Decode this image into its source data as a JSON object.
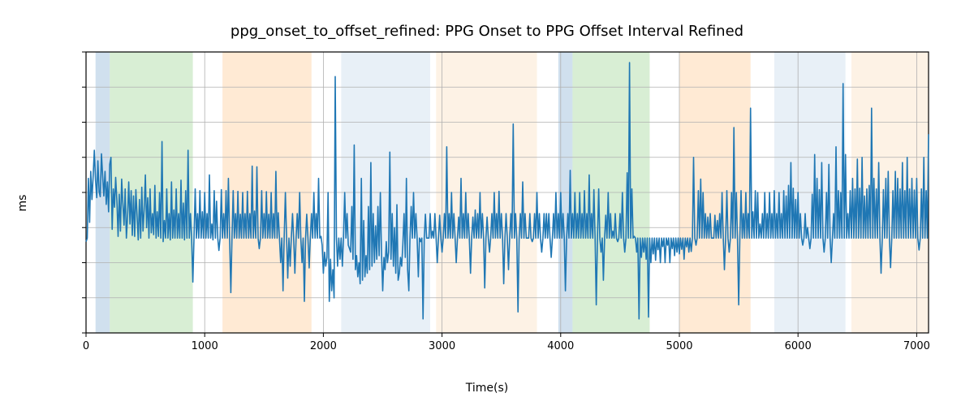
{
  "chart_data": {
    "type": "line",
    "title": "ppg_onset_to_offset_refined: PPG Onset to PPG Offset Interval Refined",
    "xlabel": "Time(s)",
    "ylabel": "ms",
    "xlim": [
      0,
      7100
    ],
    "ylim": [
      600,
      1400
    ],
    "xticks": [
      0,
      1000,
      2000,
      3000,
      4000,
      5000,
      6000,
      7000
    ],
    "yticks": [
      600,
      700,
      800,
      900,
      1000,
      1100,
      1200,
      1300,
      1400
    ],
    "grid": true,
    "regions": [
      {
        "x0": 80,
        "x1": 200,
        "color": "#a9c6e0"
      },
      {
        "x0": 200,
        "x1": 900,
        "color": "#b8e0b0"
      },
      {
        "x0": 1150,
        "x1": 1900,
        "color": "#ffd8b0"
      },
      {
        "x0": 2150,
        "x1": 2900,
        "color": "#d6e4f0"
      },
      {
        "x0": 2950,
        "x1": 3800,
        "color": "#fce8d0"
      },
      {
        "x0": 3980,
        "x1": 4100,
        "color": "#a9c6e0"
      },
      {
        "x0": 4100,
        "x1": 4750,
        "color": "#b8e0b0"
      },
      {
        "x0": 5000,
        "x1": 5600,
        "color": "#ffd8b0"
      },
      {
        "x0": 5800,
        "x1": 6400,
        "color": "#d6e4f0"
      },
      {
        "x0": 6450,
        "x1": 7100,
        "color": "#fce8d0"
      }
    ],
    "series": [
      {
        "name": "ppg_onset_to_offset_refined",
        "color": "#1f77b4",
        "x_step": 10,
        "values": [
          860,
          870,
          1040,
          915,
          1060,
          980,
          1048,
          1120,
          1035,
          985,
          1090,
          1002,
          988,
          1110,
          1045,
          990,
          1060,
          966,
          1030,
          945,
          1080,
          1100,
          895,
          1010,
          958,
          1043,
          978,
          875,
          995,
          890,
          1038,
          970,
          907,
          1010,
          870,
          933,
          1030,
          910,
          1005,
          878,
          990,
          875,
          1008,
          932,
          865,
          980,
          870,
          1015,
          890,
          950,
          1050,
          900,
          985,
          870,
          1010,
          885,
          940,
          880,
          1020,
          870,
          945,
          875,
          1000,
          870,
          1145,
          860,
          920,
          870,
          1010,
          870,
          940,
          865,
          1030,
          870,
          950,
          870,
          1010,
          870,
          940,
          870,
          1035,
          870,
          970,
          865,
          1005,
          870,
          1120,
          870,
          940,
          870,
          745,
          870,
          1010,
          870,
          940,
          870,
          1005,
          870,
          945,
          870,
          1000,
          870,
          940,
          870,
          1050,
          870,
          910,
          865,
          1005,
          870,
          975,
          870,
          835,
          870,
          1008,
          870,
          940,
          870,
          1005,
          870,
          1040,
          870,
          715,
          870,
          1005,
          870,
          940,
          870,
          1003,
          870,
          938,
          870,
          1000,
          870,
          940,
          870,
          1003,
          870,
          940,
          870,
          1075,
          870,
          947,
          870,
          1073,
          870,
          840,
          870,
          1005,
          870,
          940,
          870,
          1002,
          870,
          938,
          870,
          1000,
          870,
          940,
          870,
          1060,
          870,
          942,
          870,
          800,
          870,
          720,
          870,
          1000,
          870,
          756,
          870,
          790,
          870,
          940,
          870,
          770,
          870,
          940,
          870,
          1000,
          870,
          800,
          870,
          690,
          870,
          938,
          870,
          785,
          870,
          940,
          870,
          1000,
          870,
          940,
          870,
          1040,
          870,
          875,
          850,
          770,
          830,
          790,
          815,
          1000,
          690,
          810,
          720,
          780,
          700,
          1330,
          870,
          790,
          870,
          810,
          870,
          790,
          870,
          1000,
          870,
          940,
          850,
          840,
          830,
          960,
          810,
          1135,
          780,
          820,
          760,
          800,
          740,
          1040,
          750,
          920,
          760,
          820,
          770,
          960,
          780,
          1085,
          790,
          940,
          800,
          905,
          810,
          960,
          820,
          1000,
          830,
          720,
          815,
          780,
          860,
          800,
          830,
          1115,
          810,
          940,
          790,
          900,
          770,
          965,
          750,
          770,
          815,
          790,
          850,
          940,
          815,
          1040,
          780,
          720,
          870,
          960,
          870,
          1000,
          870,
          940,
          870,
          760,
          870,
          860,
          870,
          640,
          870,
          938,
          870,
          870,
          870,
          940,
          870,
          890,
          870,
          940,
          870,
          800,
          870,
          935,
          870,
          830,
          870,
          940,
          870,
          1130,
          870,
          940,
          870,
          1000,
          870,
          940,
          870,
          800,
          870,
          930,
          870,
          1040,
          870,
          940,
          870,
          1000,
          870,
          940,
          870,
          770,
          870,
          930,
          870,
          950,
          870,
          940,
          870,
          1000,
          870,
          940,
          870,
          728,
          870,
          930,
          870,
          830,
          870,
          940,
          870,
          1000,
          870,
          940,
          870,
          1003,
          870,
          940,
          870,
          740,
          870,
          940,
          870,
          780,
          870,
          940,
          870,
          1195,
          870,
          940,
          870,
          660,
          870,
          940,
          870,
          1030,
          870,
          940,
          870,
          870,
          870,
          940,
          870,
          860,
          870,
          940,
          870,
          1000,
          870,
          940,
          870,
          830,
          870,
          940,
          870,
          940,
          870,
          940,
          870,
          815,
          870,
          940,
          870,
          1000,
          870,
          940,
          870,
          1000,
          870,
          940,
          870,
          720,
          870,
          940,
          870,
          1063,
          870,
          940,
          870,
          1000,
          870,
          940,
          870,
          1000,
          870,
          940,
          870,
          1005,
          870,
          940,
          870,
          1050,
          870,
          940,
          870,
          1008,
          870,
          680,
          870,
          1010,
          870,
          830,
          870,
          750,
          870,
          935,
          870,
          1000,
          870,
          940,
          870,
          890,
          870,
          940,
          870,
          860,
          870,
          940,
          870,
          1000,
          870,
          830,
          870,
          1056,
          870,
          1370,
          870,
          1010,
          870,
          875,
          870,
          830,
          870,
          640,
          870,
          815,
          870,
          830,
          870,
          810,
          870,
          645,
          870,
          800,
          870,
          825,
          870,
          807,
          870,
          837,
          870,
          800,
          870,
          846,
          870,
          800,
          870,
          850,
          870,
          800,
          870,
          840,
          870,
          820,
          870,
          830,
          870,
          825,
          870,
          838,
          870,
          810,
          870,
          845,
          870,
          830,
          870,
          832,
          870,
          1100,
          870,
          850,
          870,
          1005,
          870,
          1038,
          870,
          1000,
          870,
          940,
          870,
          930,
          870,
          940,
          870,
          870,
          870,
          935,
          870,
          920,
          870,
          940,
          870,
          1000,
          870,
          780,
          870,
          1005,
          870,
          830,
          870,
          1000,
          870,
          1185,
          870,
          1000,
          870,
          680,
          870,
          1005,
          870,
          940,
          870,
          1000,
          870,
          940,
          870,
          1240,
          870,
          945,
          870,
          1005,
          870,
          1000,
          870,
          910,
          870,
          940,
          870,
          1000,
          870,
          940,
          870,
          1000,
          870,
          940,
          870,
          1005,
          870,
          940,
          870,
          1000,
          870,
          940,
          870,
          1005,
          870,
          990,
          870,
          1020,
          870,
          1085,
          870,
          1012,
          870,
          980,
          870,
          1000,
          870,
          940,
          870,
          850,
          870,
          940,
          870,
          900,
          870,
          840,
          870,
          995,
          870,
          1108,
          870,
          1040,
          870,
          1008,
          870,
          1085,
          870,
          830,
          870,
          1000,
          870,
          1080,
          870,
          800,
          870,
          940,
          870,
          1130,
          870,
          1005,
          870,
          1000,
          870,
          1310,
          870,
          1108,
          870,
          940,
          870,
          1005,
          870,
          1040,
          870,
          1010,
          870,
          1095,
          870,
          1012,
          870,
          1100,
          870,
          990,
          870,
          1010,
          870,
          1020,
          870,
          1240,
          870,
          1040,
          870,
          1010,
          870,
          1085,
          870,
          770,
          870,
          1008,
          870,
          1040,
          870,
          1060,
          870,
          786,
          870,
          1005,
          870,
          1060,
          870,
          1040,
          870,
          1010,
          870,
          1085,
          870,
          1005,
          870,
          1100,
          870,
          1010,
          870,
          1040,
          870,
          1007,
          870,
          1040,
          870,
          836,
          870,
          1010,
          870,
          1100,
          870,
          1005,
          870,
          1166,
          810
        ]
      }
    ]
  }
}
